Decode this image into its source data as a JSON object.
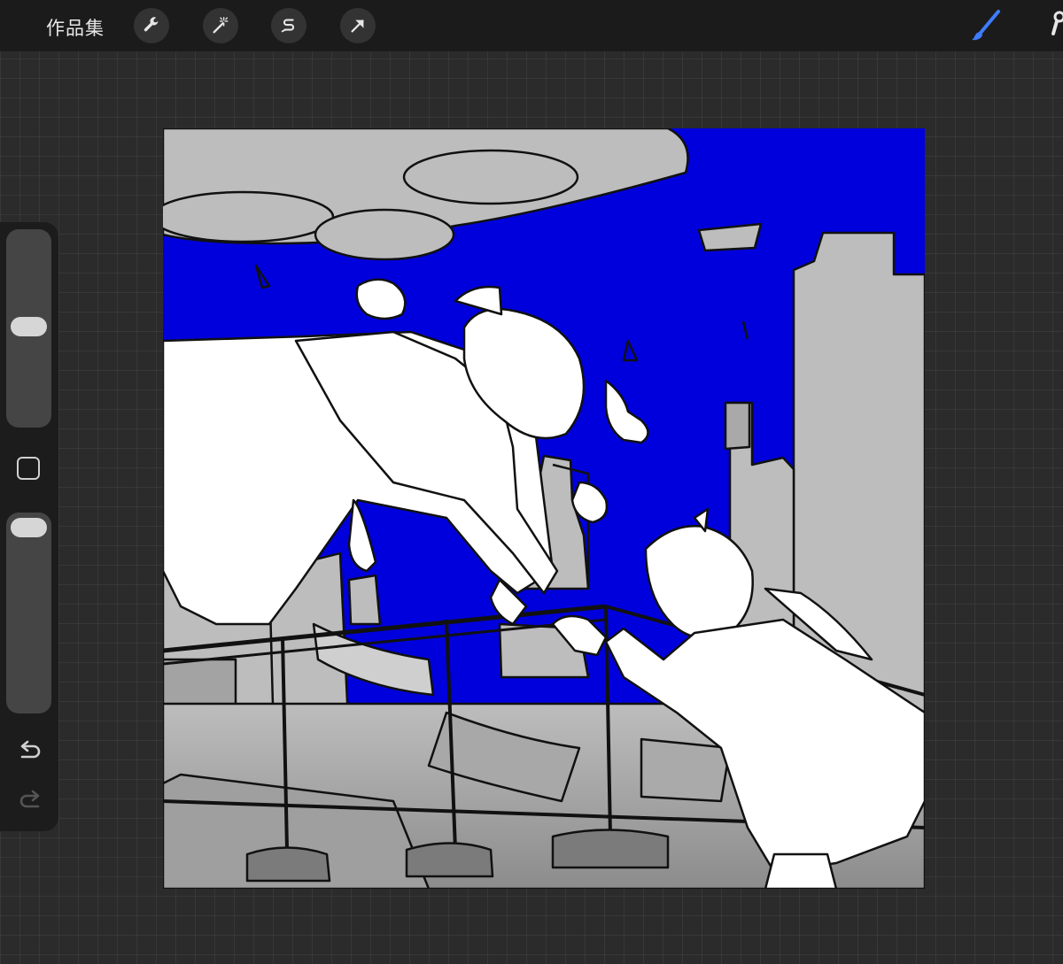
{
  "topbar": {
    "gallery_label": "作品集",
    "tools": [
      {
        "name": "wrench-icon",
        "label": "actions"
      },
      {
        "name": "magic-wand-icon",
        "label": "adjustments"
      },
      {
        "name": "selection-s-icon",
        "label": "selection"
      },
      {
        "name": "arrow-cursor-icon",
        "label": "transform"
      }
    ],
    "active_tool": "brush-icon",
    "accent_color": "#3d7cff"
  },
  "sidebar": {
    "brush_size_level": 0.45,
    "opacity_level": 0.05,
    "modify_icon": "square-icon",
    "undo_icon": "undo-icon",
    "redo_icon": "redo-icon"
  },
  "canvas": {
    "background_color": "#0000dc",
    "subject": "artwork"
  }
}
